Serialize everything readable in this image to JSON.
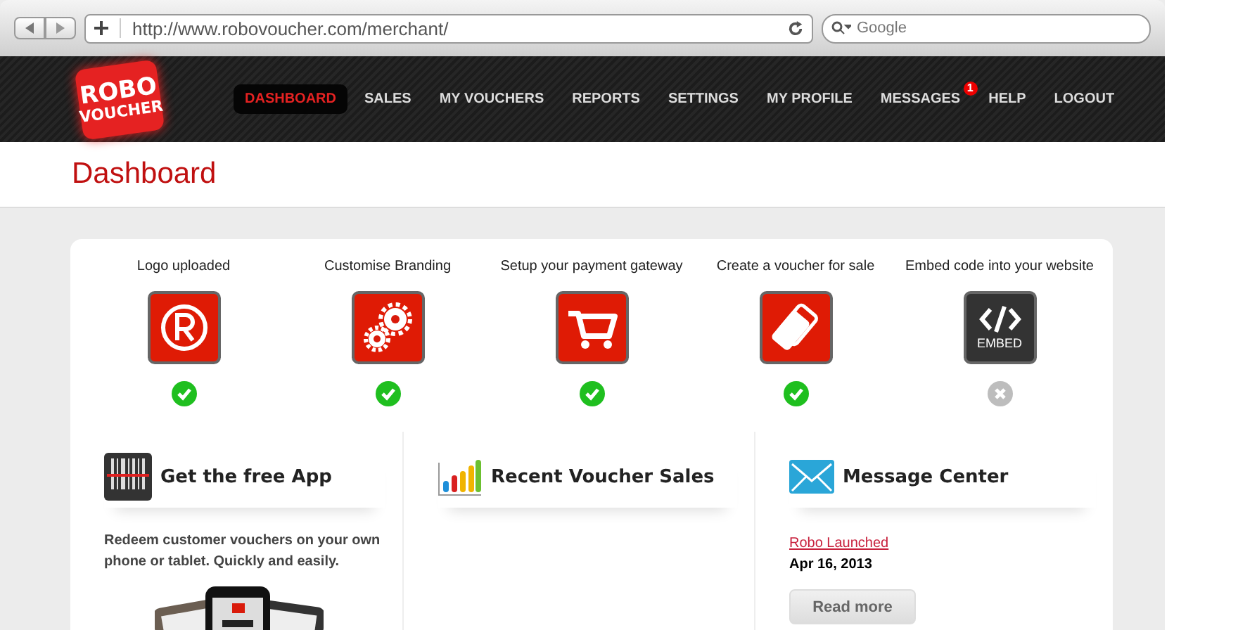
{
  "browser": {
    "url": "http://www.robovoucher.com/merchant/",
    "search": {
      "placeholder": "Google"
    }
  },
  "logo": {
    "line_1": "ROBO",
    "line_2": "VOUCHER"
  },
  "nav": [
    {
      "label": "DASHBOARD",
      "selected": true
    },
    {
      "label": "SALES",
      "selected": false
    },
    {
      "label": "MY VOUCHERS",
      "selected": false
    },
    {
      "label": "REPORTS",
      "selected": false
    },
    {
      "label": "SETTINGS",
      "selected": false
    },
    {
      "label": "MY PROFILE",
      "selected": false
    },
    {
      "label": "MESSAGES",
      "selected": false,
      "badge": "1"
    },
    {
      "label": "HELP",
      "selected": false
    },
    {
      "label": "LOGOUT",
      "selected": false
    }
  ],
  "page_title": "Dashboard",
  "steps": [
    {
      "label": "Logo uploaded",
      "kind": "registered",
      "done": true
    },
    {
      "label": "Customise Branding",
      "kind": "gears",
      "done": true
    },
    {
      "label": "Setup your payment gateway",
      "kind": "cart",
      "done": true
    },
    {
      "label": "Create a voucher for sale",
      "kind": "cards",
      "done": true
    },
    {
      "label": "Embed code into your website",
      "kind": "embed",
      "icon_text": "EMBED",
      "done": false
    }
  ],
  "panels": [
    {
      "kind": "app",
      "title": "Get the free App",
      "text": "Redeem customer vouchers on your own phone or tablet. Quickly and easily."
    },
    {
      "kind": "sales",
      "title": "Recent Voucher Sales"
    },
    {
      "kind": "messages",
      "title": "Message Center",
      "message": {
        "title": "Robo Launched",
        "date": "Apr 16, 2013",
        "button": "Read more"
      }
    }
  ]
}
